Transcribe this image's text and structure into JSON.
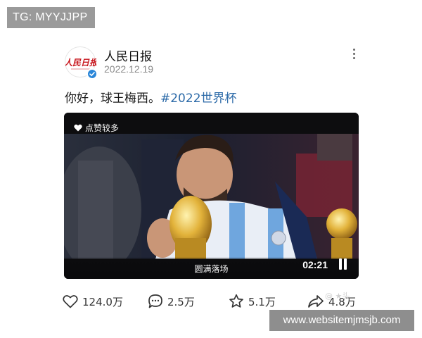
{
  "watermarks": {
    "top_left": "TG: MYYJJPP",
    "bottom_right": "www.websitemjmsjb.com",
    "faint": "@ ★头"
  },
  "author": {
    "name": "人民日报",
    "date": "2022.12.19",
    "avatar_logo_text": "人民日报",
    "verified": true
  },
  "post": {
    "text": "你好，球王梅西。",
    "hashtag": "#2022世界杯"
  },
  "video": {
    "badge": "点赞较多",
    "caption": "圆满落场",
    "time": "02:21",
    "badge_icon": "heart-icon",
    "control_icon": "pause-icon"
  },
  "actions": [
    {
      "icon": "heart-outline-icon",
      "count": "124.0万"
    },
    {
      "icon": "comment-icon",
      "count": "2.5万"
    },
    {
      "icon": "star-icon",
      "count": "5.1万"
    },
    {
      "icon": "share-icon",
      "count": "4.8万"
    }
  ],
  "colors": {
    "hashtag": "#2c6aa8",
    "verified": "#2a86d8",
    "logo_red": "#c8161d"
  }
}
